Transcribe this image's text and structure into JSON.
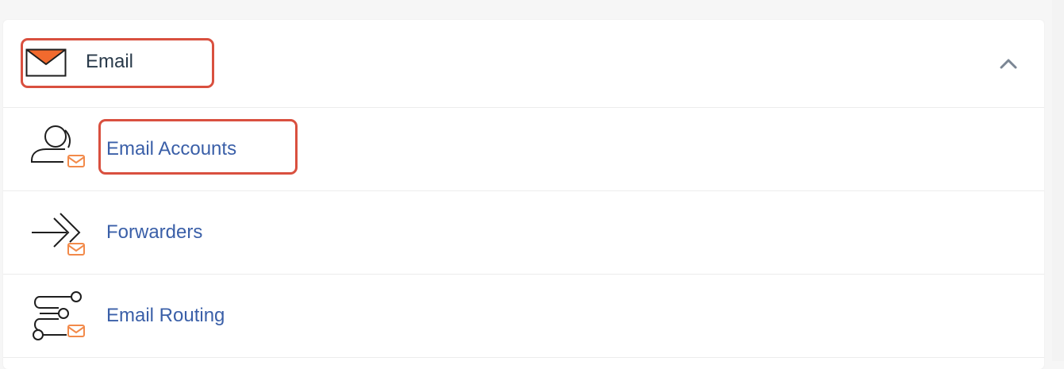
{
  "section": {
    "title": "Email",
    "icon": "email-envelope-icon",
    "collapse_icon": "chevron-up-icon",
    "accent_color": "#f26a2e",
    "highlight_color": "#d9503f"
  },
  "items": [
    {
      "label": "Email Accounts",
      "icon": "email-accounts-icon",
      "highlighted": true
    },
    {
      "label": "Forwarders",
      "icon": "forwarders-icon",
      "highlighted": false
    },
    {
      "label": "Email Routing",
      "icon": "email-routing-icon",
      "highlighted": false
    }
  ]
}
